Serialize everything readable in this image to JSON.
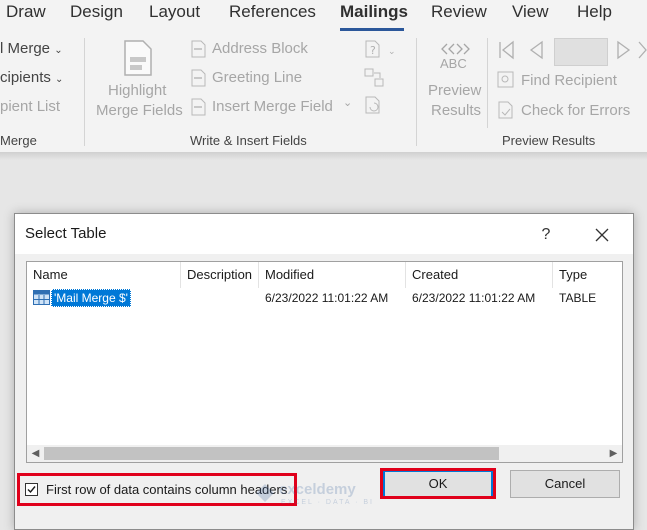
{
  "ribbon_tabs": [
    "Draw",
    "Design",
    "Layout",
    "References",
    "Mailings",
    "Review",
    "View",
    "Help"
  ],
  "active_tab": "Mailings",
  "ribbon": {
    "start_group": {
      "edit_merge": "l Merge",
      "select_recipients": "cipients",
      "recipient_list": "pient List",
      "label": "Merge"
    },
    "write_insert": {
      "highlight_line1": "Highlight",
      "highlight_line2": "Merge Fields",
      "address_block": "Address Block",
      "greeting_line": "Greeting Line",
      "insert_merge_field": "Insert Merge Field",
      "label": "Write & Insert Fields"
    },
    "preview": {
      "abc": "ABC",
      "preview_line1": "Preview",
      "preview_line2": "Results",
      "find_recipient": "Find Recipient",
      "check_errors": "Check for Errors",
      "label": "Preview Results"
    }
  },
  "dialog": {
    "title": "Select Table",
    "help": "?",
    "columns": [
      "Name",
      "Description",
      "Modified",
      "Created",
      "Type"
    ],
    "rows": [
      {
        "name": "'Mail Merge $'",
        "description": "",
        "modified": "6/23/2022 11:01:22 AM",
        "created": "6/23/2022 11:01:22 AM",
        "type": "TABLE"
      }
    ],
    "checkbox_label": "First row of data contains column headers",
    "checkbox_checked": true,
    "ok_label": "OK",
    "cancel_label": "Cancel"
  },
  "watermark": {
    "name": "exceldemy",
    "sub": "EXCEL · DATA · BI"
  },
  "colors": {
    "highlight_box": "#e0001b",
    "selection": "#0078d7",
    "active_tab_underline": "#2b579a"
  }
}
